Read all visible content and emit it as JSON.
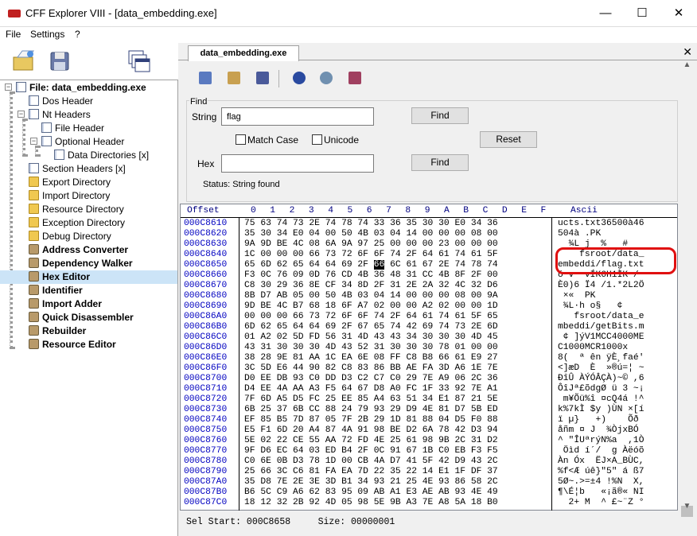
{
  "window": {
    "title": "CFF Explorer VIII - [data_embedding.exe]",
    "min": "—",
    "max": "☐",
    "close": "✕"
  },
  "menu": [
    "File",
    "Settings",
    "?"
  ],
  "tree": [
    {
      "label": "File: data_embedding.exe",
      "kind": "page",
      "bold": true
    },
    {
      "label": "Dos Header",
      "kind": "page"
    },
    {
      "label": "Nt Headers",
      "kind": "page"
    },
    {
      "label": "File Header",
      "kind": "page"
    },
    {
      "label": "Optional Header",
      "kind": "page"
    },
    {
      "label": "Data Directories [x]",
      "kind": "page"
    },
    {
      "label": "Section Headers [x]",
      "kind": "page"
    },
    {
      "label": "Export Directory",
      "kind": "folder"
    },
    {
      "label": "Import Directory",
      "kind": "folder"
    },
    {
      "label": "Resource Directory",
      "kind": "folder"
    },
    {
      "label": "Exception Directory",
      "kind": "folder"
    },
    {
      "label": "Debug Directory",
      "kind": "folder"
    },
    {
      "label": "Address Converter",
      "kind": "tool",
      "bold": true
    },
    {
      "label": "Dependency Walker",
      "kind": "tool",
      "bold": true
    },
    {
      "label": "Hex Editor",
      "kind": "tool",
      "bold": true,
      "selected": true
    },
    {
      "label": "Identifier",
      "kind": "tool",
      "bold": true
    },
    {
      "label": "Import Adder",
      "kind": "tool",
      "bold": true
    },
    {
      "label": "Quick Disassembler",
      "kind": "tool",
      "bold": true
    },
    {
      "label": "Rebuilder",
      "kind": "tool",
      "bold": true
    },
    {
      "label": "Resource Editor",
      "kind": "tool",
      "bold": true
    }
  ],
  "tab": {
    "label": "data_embedding.exe",
    "close": "✕"
  },
  "find": {
    "caption": "Find",
    "string_label": "String",
    "string_value": "flag",
    "find_label": "Find",
    "match_case": "Match Case",
    "unicode": "Unicode",
    "reset": "Reset",
    "hex_label": "Hex",
    "hex_value": "",
    "status": "Status: String found"
  },
  "hex": {
    "header_offset": "Offset",
    "header_cols": [
      "0",
      "1",
      "2",
      "3",
      "4",
      "5",
      "6",
      "7",
      "8",
      "9",
      "A",
      "B",
      "C",
      "D",
      "E",
      "F"
    ],
    "header_ascii": "Ascii",
    "rows": [
      {
        "off": "000C8610",
        "hex": "75 63 74 73 2E 74 78 74 33 36 35 30 30 E0 34 36",
        "ascii": "ucts.txt36500à46"
      },
      {
        "off": "000C8620",
        "hex": "35 30 34 E0 04 00 50 4B 03 04 14 00 00 00 08 00",
        "ascii": "504à .PK       "
      },
      {
        "off": "000C8630",
        "hex": "9A 9D BE 4C 08 6A 9A 97 25 00 00 00 23 00 00 00",
        "ascii": "  ¾L j  %   #   "
      },
      {
        "off": "000C8640",
        "hex": "1C 00 00 00 66 73 72 6F 6F 74 2F 64 61 74 61 5F",
        "ascii": "    fsroot/data_"
      },
      {
        "off": "000C8650",
        "hex": "65 6D 62 65 64 64 69 2F 66 6C 61 67 2E 74 78 74",
        "ascii": "embeddi/flag.txt",
        "sel": 8
      },
      {
        "off": "000C8660",
        "hex": "F3 0C 76 09 0D 76 CD 4B 36 48 31 CC 4B 8F 2F 00",
        "ascii": "ó v  vÍK6H1ÌK /"
      },
      {
        "off": "000C8670",
        "hex": "C8 30 29 36 8E CF 34 8D 2F 31 2E 2A 32 4C 32 D6",
        "ascii": "È0)6 Ï4 /1.*2L2Ö"
      },
      {
        "off": "000C8680",
        "hex": "8B D7 AB 05 00 50 4B 03 04 14 00 00 00 08 00 9A",
        "ascii": " ×«  PK         "
      },
      {
        "off": "000C8690",
        "hex": "9D BE 4C B7 68 18 6F A7 02 00 00 A2 02 00 00 1D",
        "ascii": " ¾L·h o§   ¢    "
      },
      {
        "off": "000C86A0",
        "hex": "00 00 00 66 73 72 6F 6F 74 2F 64 61 74 61 5F 65",
        "ascii": "   fsroot/data_e"
      },
      {
        "off": "000C86B0",
        "hex": "6D 62 65 64 64 69 2F 67 65 74 42 69 74 73 2E 6D",
        "ascii": "mbeddi/getBits.m"
      },
      {
        "off": "000C86C0",
        "hex": "01 A2 02 5D FD 56 31 4D 43 43 34 30 30 30 4D 45",
        "ascii": " ¢ ]ýV1MCC4000ME"
      },
      {
        "off": "000C86D0",
        "hex": "43 31 30 30 30 4D 43 52 31 30 30 30 78 01 00 00",
        "ascii": "C1000MCR1000x   "
      },
      {
        "off": "000C86E0",
        "hex": "38 28 9E 81 AA 1C EA 6E 08 FF C8 B8 66 61 E9 27",
        "ascii": "8(  ª ên ÿÈ¸faé'"
      },
      {
        "off": "000C86F0",
        "hex": "3C 5D E6 44 90 82 C8 83 86 BB AE FA 3D A6 1E 7E",
        "ascii": "<]æD  È  »®ú=¦ ~"
      },
      {
        "off": "000C8700",
        "hex": "D0 EE DB 93 C0 DD D3 C2 C7 C0 29 7E A9 06 2C 36",
        "ascii": "ÐîÛ ÀÝÓÂÇÀ)~© ,6"
      },
      {
        "off": "000C8710",
        "hex": "D4 EE 4A AA A3 F5 64 67 D8 A0 FC 1F 33 92 7E A1",
        "ascii": "ÔîJª£õdgØ ü 3 ~¡"
      },
      {
        "off": "000C8720",
        "hex": "7F 6D A5 D5 FC 25 EE 85 A4 63 51 34 E1 87 21 5E",
        "ascii": " m¥Õü%î ¤cQ4á !^"
      },
      {
        "off": "000C8730",
        "hex": "6B 25 37 6B CC 88 24 79 93 29 D9 4E 81 D7 5B ED",
        "ascii": "k%7kÌ $y )ÙN ×[í"
      },
      {
        "off": "000C8740",
        "hex": "EF 85 B5 7D 87 05 7F 2B 29 1D 81 88 04 D5 F0 88",
        "ascii": "ï µ}   +)    Õð "
      },
      {
        "off": "000C8750",
        "hex": "E5 F1 6D 20 A4 87 4A 91 98 BE D2 6A 78 42 D3 94",
        "ascii": "åñm ¤ J  ¾ÒjxBÓ "
      },
      {
        "off": "000C8760",
        "hex": "5E 02 22 CE 55 AA 72 FD 4E 25 61 98 9B 2C 31 D2",
        "ascii": "^ \"ÎUªrýN%a  ,1Ò"
      },
      {
        "off": "000C8770",
        "hex": "9F D6 EC 64 03 ED B4 2F 0C 91 67 1B C0 EB F3 F5",
        "ascii": " Öìd í´/  g Àëóõ"
      },
      {
        "off": "000C8780",
        "hex": "C0 6E 0B D3 78 1D 00 CB 4A D7 41 5F 42 D9 43 2C",
        "ascii": "Àn Óx  ËJ×A_BÙC,"
      },
      {
        "off": "000C8790",
        "hex": "25 66 3C C6 81 FA EA 7D 22 35 22 14 E1 1F DF 37",
        "ascii": "%f<Æ úê}\"5\" á ß7"
      },
      {
        "off": "000C87A0",
        "hex": "35 D8 7E 2E 3E 3D B1 34 93 21 25 4E 93 86 58 2C",
        "ascii": "5Ø~.>=±4 !%N  X,"
      },
      {
        "off": "000C87B0",
        "hex": "B6 5C C9 A6 62 83 95 09 AB A1 E3 AE AB 93 4E 49",
        "ascii": "¶\\É¦b   «¡ã®« NI"
      },
      {
        "off": "000C87C0",
        "hex": "18 12 32 2B 92 4D 05 98 5E 9B A3 7E A8 5A 18 B0",
        "ascii": "  2+ M  ^ £~¨Z °"
      }
    ],
    "status": "Sel Start: 000C8658     Size: 00000001"
  },
  "colors": {
    "selection": "#cce4f7",
    "offset": "#0000c0",
    "highlight": "#e01010"
  }
}
